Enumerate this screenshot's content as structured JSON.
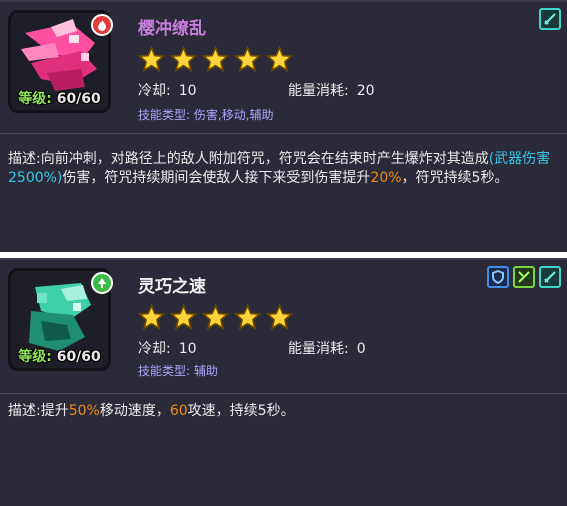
{
  "skills": [
    {
      "name": "樱冲缭乱",
      "level_label": "等级:",
      "level_value": "60/60",
      "stars": 5,
      "cooldown_label": "冷却:",
      "cooldown_value": "10",
      "energy_label": "能量消耗:",
      "energy_value": "20",
      "type_label": "技能类型:",
      "type_value": "伤害,移动,辅助",
      "desc_label": "描述:",
      "desc_part1": "向前冲刺，对路径上的敌人附加符咒，符咒会在结束时产生爆炸对其造成",
      "desc_hl1": "(武器伤害2500%)",
      "desc_part2": "伤害，符咒持续期间会使敌人接下来受到伤害提升",
      "desc_hl2": "20%",
      "desc_part3": "，符咒持续5秒。",
      "element_color": "#e23b3b",
      "corner_icons": [
        "sword-icon"
      ]
    },
    {
      "name": "灵巧之速",
      "level_label": "等级:",
      "level_value": "60/60",
      "stars": 5,
      "cooldown_label": "冷却:",
      "cooldown_value": "10",
      "energy_label": "能量消耗:",
      "energy_value": "0",
      "type_label": "技能类型:",
      "type_value": "辅助",
      "desc_label": "描述:",
      "desc_part1": "提升",
      "desc_hl1": "50%",
      "desc_part2": "移动速度，",
      "desc_hl2": "60",
      "desc_part3": "攻速，持续5秒。",
      "element_color": "#3dbb46",
      "corner_icons": [
        "shield-icon",
        "weapon-swap-icon",
        "sword-icon"
      ]
    }
  ]
}
